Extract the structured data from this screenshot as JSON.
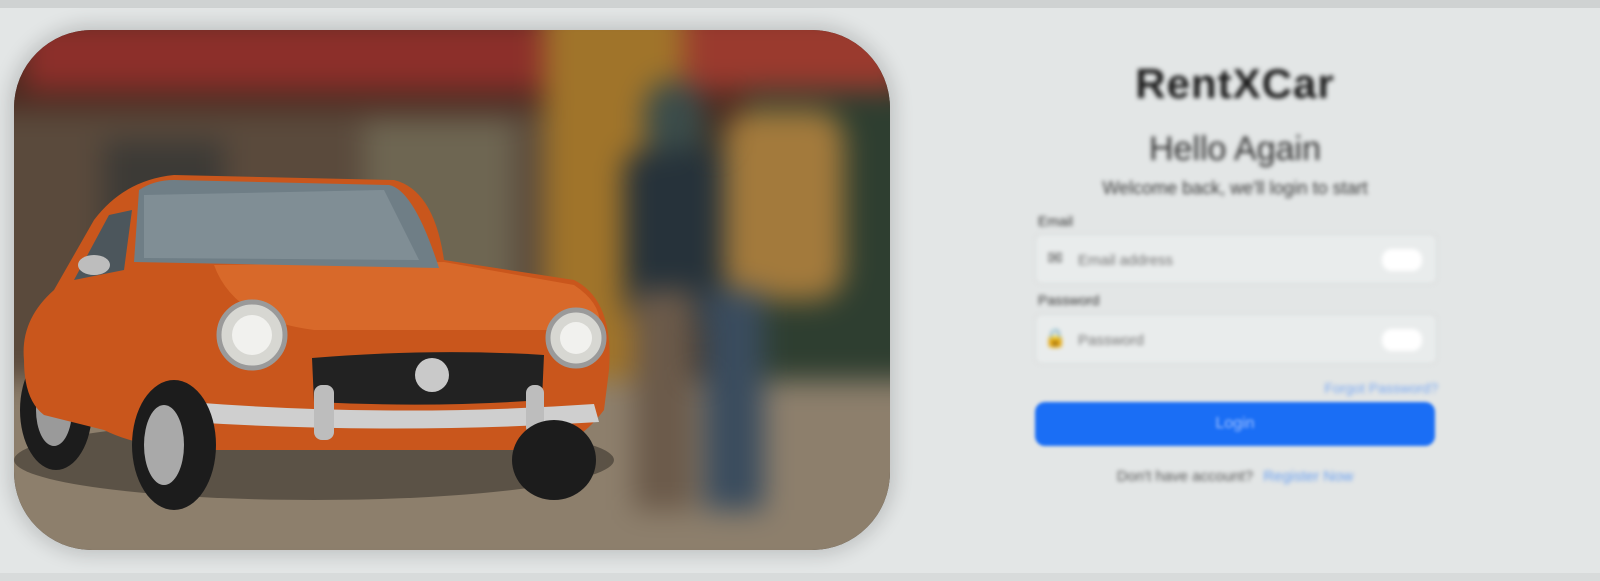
{
  "hero": {
    "image_description_icon": "car-photo"
  },
  "login": {
    "brand": "RentXCar",
    "greeting": "Hello Again",
    "subtitle": "Welcome back, we'll login to start",
    "email_label": "Email",
    "email_placeholder": "Email address",
    "email_icon": "mail-icon",
    "password_label": "Password",
    "password_placeholder": "Password",
    "password_icon": "lock-icon",
    "forgot_password": "Forgot Password?",
    "login_button": "Login",
    "signup_prompt": "Don't have account?",
    "signup_link": "Register Now"
  },
  "colors": {
    "background": "#e3e6e6",
    "primary_button": "#1a6ef5",
    "link": "#6aa0f0",
    "car_body": "#c9561c"
  }
}
